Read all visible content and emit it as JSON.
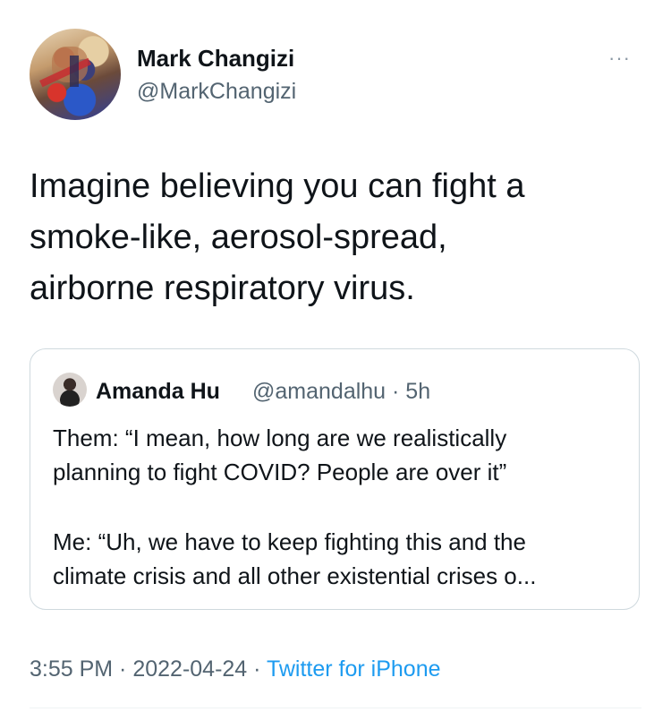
{
  "author": {
    "name": "Mark Changizi",
    "handle": "@MarkChangizi",
    "avatar_icon": "painted-portrait-avatar"
  },
  "more_label": "···",
  "tweet": {
    "lines": [
      "Imagine believing you can fight a",
      "smoke-like, aerosol-spread,",
      "airborne respiratory virus."
    ]
  },
  "quote": {
    "name": "Amanda Hu",
    "handle_time": "@amandalhu · 5h",
    "paragraph1": [
      "Them: “I mean, how long are we realistically",
      "planning to fight COVID? People are over it”"
    ],
    "paragraph2": [
      "Me: “Uh, we have to keep fighting this and the",
      "climate crisis and all other existential crises o..."
    ]
  },
  "meta": {
    "time": "3:55 PM",
    "sep1": " · ",
    "date": "2022-04-24",
    "sep2": " · ",
    "source": "Twitter for iPhone"
  },
  "colors": {
    "text": "#0f1419",
    "secondary": "#536471",
    "link": "#1d9bf0",
    "border": "#cfd9de"
  }
}
